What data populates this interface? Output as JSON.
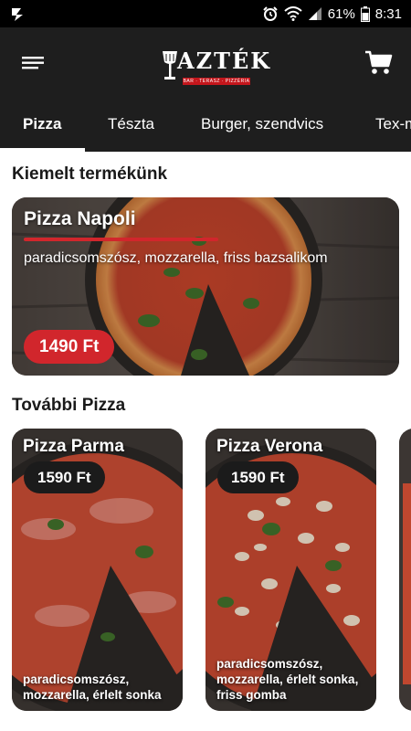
{
  "status": {
    "battery": "61%",
    "time": "8:31"
  },
  "brand": {
    "name": "AZTÉK",
    "tagline": "BAR · TERASZ · PIZZÉRIA"
  },
  "tabs": [
    {
      "label": "Pizza",
      "active": true
    },
    {
      "label": "Tészta"
    },
    {
      "label": "Burger, szendvics"
    },
    {
      "label": "Tex-m"
    }
  ],
  "featured": {
    "section_title": "Kiemelt termékünk",
    "name": "Pizza Napoli",
    "description": "paradicsomszósz, mozzarella, friss bazsalikom",
    "price": "1490 Ft"
  },
  "more": {
    "section_title": "További  Pizza",
    "items": [
      {
        "name": "Pizza Parma",
        "price": "1590 Ft",
        "description": "paradicsomszósz, mozzarella, érlelt sonka"
      },
      {
        "name": "Pizza Verona",
        "price": "1590 Ft",
        "description": "paradicsomszósz, mozzarella, érlelt sonka, friss gomba"
      }
    ]
  },
  "colors": {
    "header": "#1e1e1e",
    "accent": "#d1262c",
    "price_dark": "#1b1b1b"
  },
  "icons": {
    "menu": "hamburger-icon",
    "cart": "cart-icon",
    "wifi": "wifi-icon",
    "signal": "signal-icon",
    "battery": "battery-icon",
    "alarm": "alarm-icon"
  }
}
